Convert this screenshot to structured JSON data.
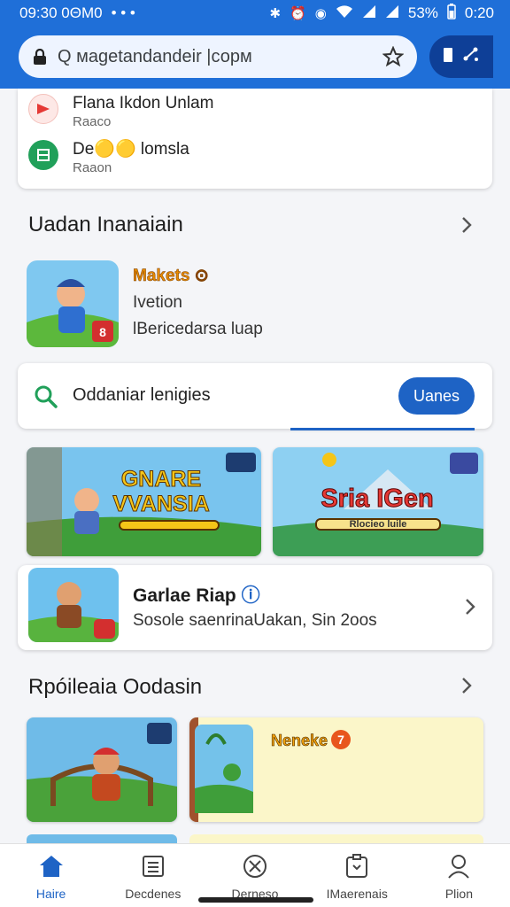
{
  "status": {
    "time": "09:30 0ΘM0",
    "dots": "• • •",
    "battery": "53%",
    "clock": "0:20"
  },
  "browser": {
    "url": "Q мagetandandeir |сорм"
  },
  "recent": [
    {
      "title": "Flana Ikdon Unlam",
      "sub": "Raaco",
      "icon": "video-icon",
      "color": "#e53935"
    },
    {
      "title": "De🟡🟡 lomsla",
      "sub": "Raaon",
      "icon": "grid-icon",
      "color": "#21a05a"
    }
  ],
  "section1": {
    "title": "Uadan Inanaiain"
  },
  "featured": {
    "name": "Makets ⊙",
    "line1": "Ivetion",
    "line2": "lBericedarsa luap"
  },
  "search": {
    "text": "Oddaniar lenigies",
    "button": "Uanes"
  },
  "banners": [
    {
      "title": "GNARE VVANSIA",
      "accent": "#f5c518"
    },
    {
      "title": "Sria IGen",
      "sub": "Rlocieo luile",
      "accent": "#e53935"
    }
  ],
  "game_card": {
    "name": "Garlae Riap",
    "desc": "Sosole saenrinaUakan, Sin 2oos"
  },
  "section2": {
    "title": "Rpóileaia Oodasin"
  },
  "promo": {
    "tag": "Neneke",
    "badge": "7"
  },
  "nav": [
    {
      "label": "Haire",
      "icon": "home-icon",
      "active": true
    },
    {
      "label": "Decdenes",
      "icon": "list-icon",
      "active": false
    },
    {
      "label": "Derneso",
      "icon": "compass-icon",
      "active": false
    },
    {
      "label": "IMaerenais",
      "icon": "download-icon",
      "active": false
    },
    {
      "label": "Plion",
      "icon": "person-icon",
      "active": false
    }
  ],
  "colors": {
    "brand": "#1f6fd8",
    "accent": "#1e63c5"
  }
}
